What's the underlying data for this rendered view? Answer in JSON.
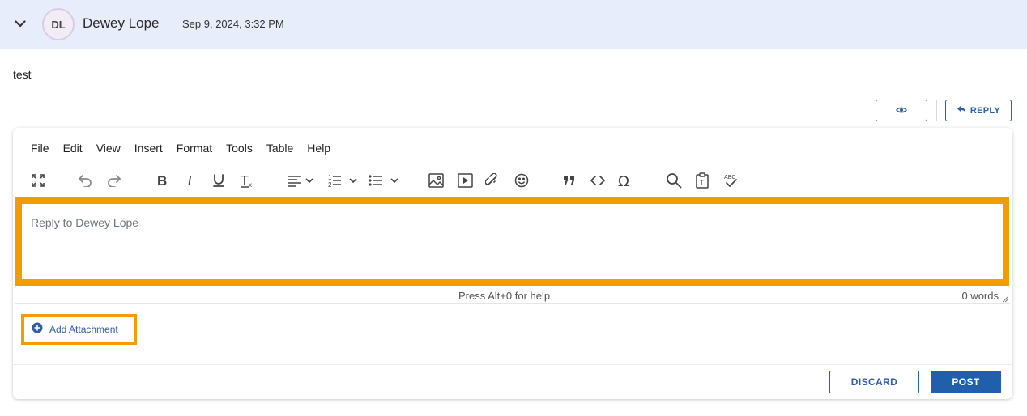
{
  "post": {
    "author_initials": "DL",
    "author_name": "Dewey Lope",
    "timestamp": "Sep 9, 2024, 3:32 PM",
    "message": "test"
  },
  "actions": {
    "preview_icon": "eye-icon",
    "reply_label": "REPLY"
  },
  "editor": {
    "menu": [
      "File",
      "Edit",
      "View",
      "Insert",
      "Format",
      "Tools",
      "Table",
      "Help"
    ],
    "toolbar": [
      "fullscreen",
      "undo",
      "redo",
      "bold",
      "italic",
      "underline",
      "clear-formatting",
      "align",
      "numbered-list",
      "bulleted-list",
      "image",
      "media",
      "link",
      "emoji",
      "blockquote",
      "code",
      "special-character",
      "search",
      "paste-as-text",
      "spellcheck"
    ],
    "placeholder": "Reply to Dewey Lope",
    "help_text": "Press Alt+0 for help",
    "word_count": "0 words"
  },
  "attachment": {
    "label": "Add Attachment"
  },
  "footer": {
    "discard_label": "DISCARD",
    "post_label": "POST"
  },
  "colors": {
    "accent": "#2f5ea8",
    "highlight": "#f59b00",
    "header_bg": "#e8edfb"
  }
}
